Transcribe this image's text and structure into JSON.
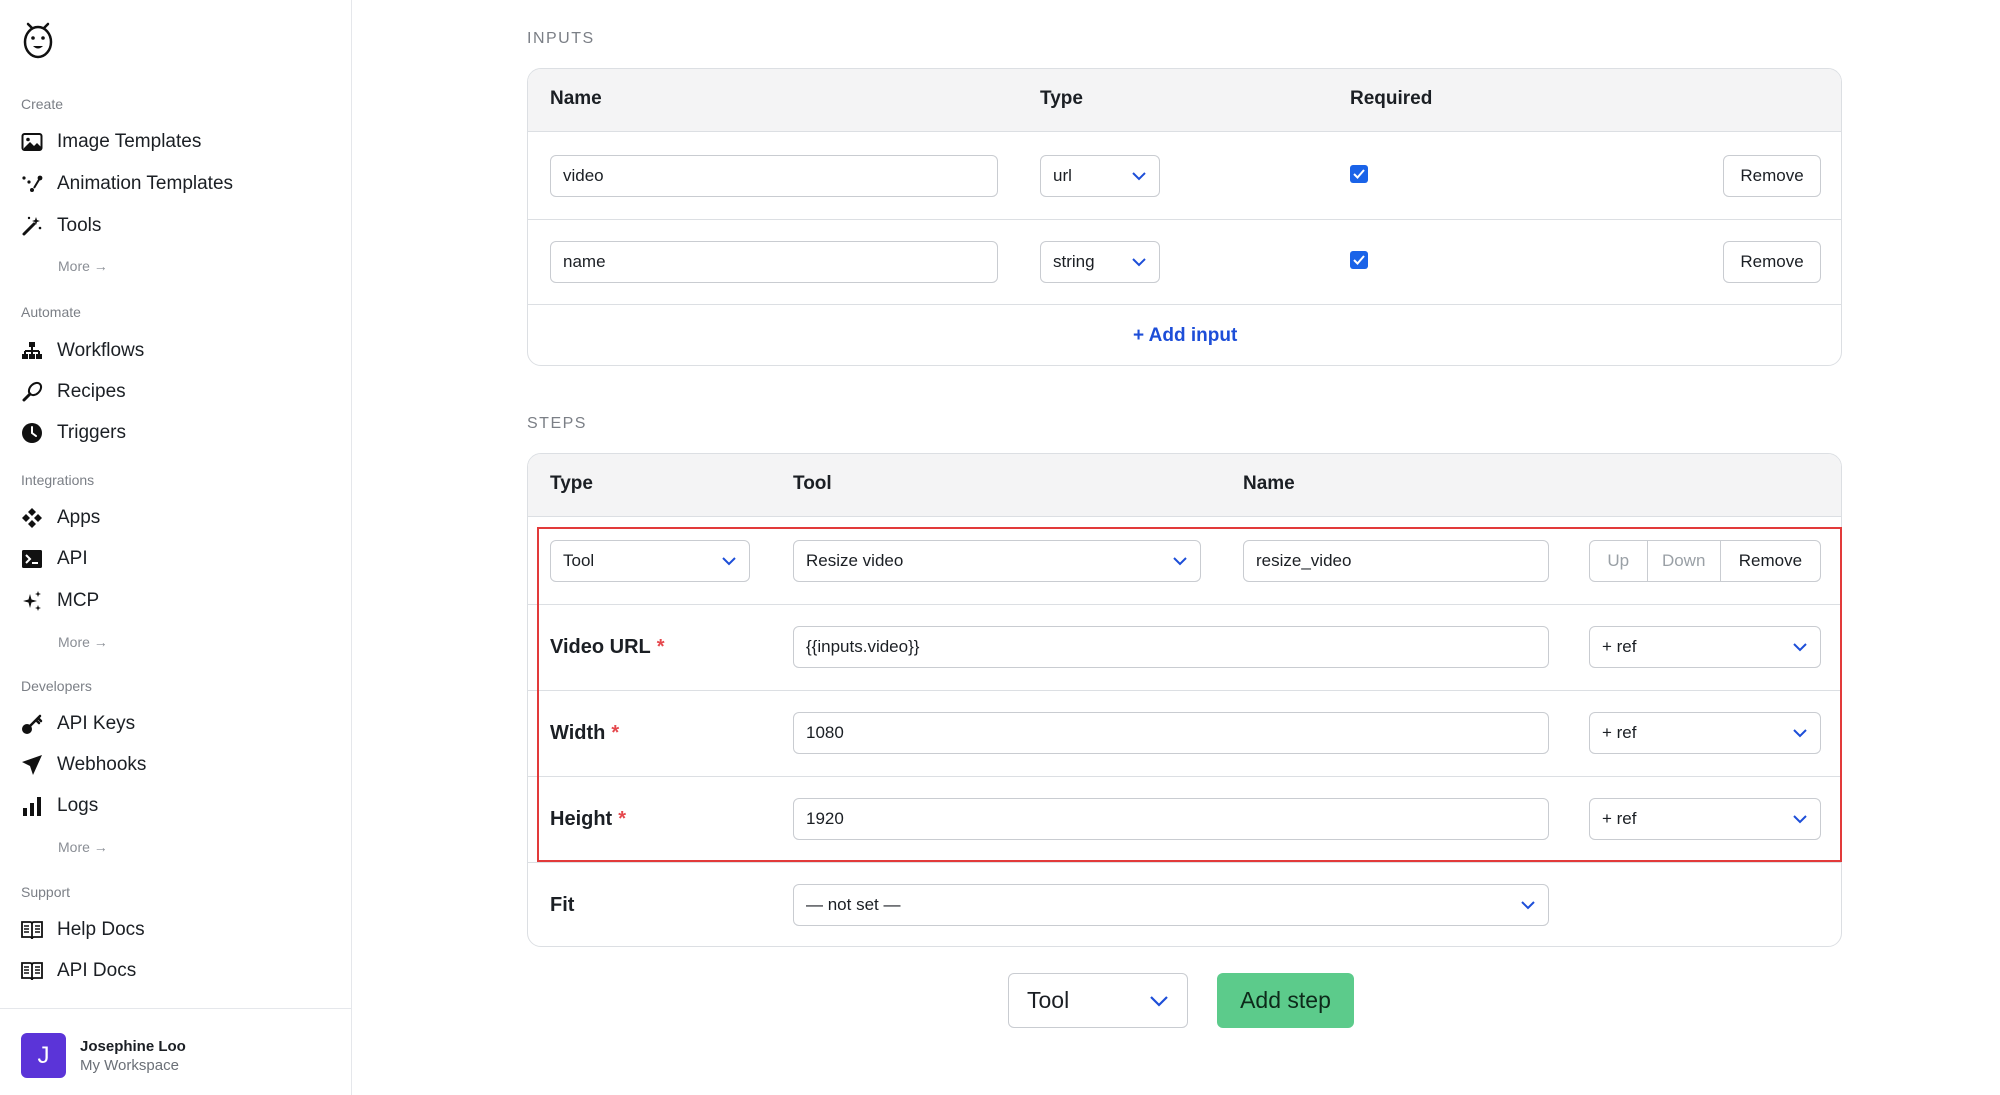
{
  "sidebar": {
    "sections": {
      "create": "Create",
      "automate": "Automate",
      "integrations": "Integrations",
      "developers": "Developers",
      "support": "Support"
    },
    "items": {
      "image_templates": "Image Templates",
      "animation_templates": "Animation Templates",
      "tools": "Tools",
      "workflows": "Workflows",
      "recipes": "Recipes",
      "triggers": "Triggers",
      "apps": "Apps",
      "api": "API",
      "mcp": "MCP",
      "api_keys": "API Keys",
      "webhooks": "Webhooks",
      "logs": "Logs",
      "help_docs": "Help Docs",
      "api_docs": "API Docs"
    },
    "more_label": "More →",
    "user": {
      "initial": "J",
      "name": "Josephine Loo",
      "workspace": "My Workspace",
      "avatar_color": "#5b34d8"
    }
  },
  "inputs": {
    "section_title": "INPUTS",
    "headers": {
      "name": "Name",
      "type": "Type",
      "required": "Required"
    },
    "rows": [
      {
        "name": "video",
        "type": "url",
        "required": true,
        "remove_label": "Remove"
      },
      {
        "name": "name",
        "type": "string",
        "required": true,
        "remove_label": "Remove"
      }
    ],
    "add_label": "+ Add input"
  },
  "steps": {
    "section_title": "STEPS",
    "headers": {
      "type": "Type",
      "tool": "Tool",
      "name": "Name"
    },
    "step": {
      "type": "Tool",
      "tool": "Resize video",
      "name": "resize_video",
      "up_label": "Up",
      "down_label": "Down",
      "remove_label": "Remove"
    },
    "params": [
      {
        "label": "Video URL",
        "required": true,
        "value": "{{inputs.video}}",
        "ref_label": "+ ref"
      },
      {
        "label": "Width",
        "required": true,
        "value": "1080",
        "ref_label": "+ ref"
      },
      {
        "label": "Height",
        "required": true,
        "value": "1920",
        "ref_label": "+ ref"
      }
    ],
    "fit": {
      "label": "Fit",
      "value": "— not set —"
    }
  },
  "footer": {
    "step_type": "Tool",
    "add_step_label": "Add step"
  },
  "colors": {
    "accent_blue": "#1d4ed8",
    "checkbox_blue": "#1a63e8",
    "add_step_green": "#5ccb8b",
    "highlight_red": "#e23a3a",
    "required_red": "#e5484d"
  }
}
